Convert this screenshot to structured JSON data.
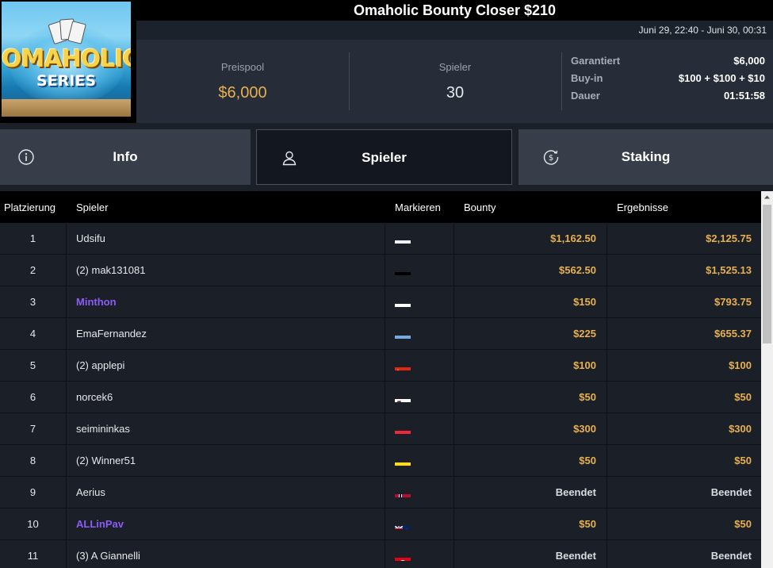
{
  "logo": {
    "line1": "OMAHOLIC",
    "line2": "SERIES"
  },
  "title": "Omaholic Bounty Closer $210",
  "dates": "Juni 29, 22:40 - Juni 30, 00:31",
  "stats": {
    "prize_label": "Preispool",
    "prize_value": "$6,000",
    "players_label": "Spieler",
    "players_value": "30",
    "details": [
      {
        "label": "Garantiert",
        "value": "$6,000"
      },
      {
        "label": "Buy-in",
        "value": "$100 + $100 + $10"
      },
      {
        "label": "Dauer",
        "value": "01:51:58"
      }
    ]
  },
  "tabs": [
    {
      "label": "Info",
      "icon": "info-icon"
    },
    {
      "label": "Spieler",
      "icon": "user-icon",
      "active": true
    },
    {
      "label": "Staking",
      "icon": "dollar-cycle-icon"
    }
  ],
  "table": {
    "headers": {
      "rank": "Platzierung",
      "player": "Spieler",
      "flag": "Markieren",
      "bounty": "Bounty",
      "result": "Ergebnisse"
    },
    "rows": [
      {
        "rank": "1",
        "name": "Udsifu",
        "flag": "poland",
        "bounty": "$1,162.50",
        "result": "$2,125.75",
        "highlight": false
      },
      {
        "rank": "2",
        "name": "(2) mak131081",
        "flag": "germany",
        "bounty": "$562.50",
        "result": "$1,525.13",
        "highlight": false
      },
      {
        "rank": "3",
        "name": "Minthon",
        "flag": "russia",
        "bounty": "$150",
        "result": "$793.75",
        "highlight": true
      },
      {
        "rank": "4",
        "name": "EmaFernandez",
        "flag": "argentina",
        "bounty": "$225",
        "result": "$655.37",
        "highlight": false
      },
      {
        "rank": "5",
        "name": "(2) applepi",
        "flag": "china",
        "bounty": "$100",
        "result": "$100",
        "highlight": false
      },
      {
        "rank": "6",
        "name": "norcek6",
        "flag": "slovenia",
        "bounty": "$50",
        "result": "$50",
        "highlight": false
      },
      {
        "rank": "7",
        "name": "seimininkas",
        "flag": "austria",
        "bounty": "$300",
        "result": "$300",
        "highlight": false
      },
      {
        "rank": "8",
        "name": "(2) Winner51",
        "flag": "ecuador",
        "bounty": "$50",
        "result": "$50",
        "highlight": false
      },
      {
        "rank": "9",
        "name": "Aerius",
        "flag": "norway",
        "bounty": "Beendet",
        "result": "Beendet",
        "highlight": false
      },
      {
        "rank": "10",
        "name": "ALLinPav",
        "flag": "new-zealand",
        "bounty": "$50",
        "result": "$50",
        "highlight": true
      },
      {
        "rank": "11",
        "name": "(3) A Giannelli",
        "flag": "tunisia",
        "bounty": "Beendet",
        "result": "Beendet",
        "highlight": false
      }
    ]
  },
  "colors": {
    "gold": "#e8b04e",
    "highlight_name": "#8b5cf6",
    "panel": "#262d38"
  }
}
